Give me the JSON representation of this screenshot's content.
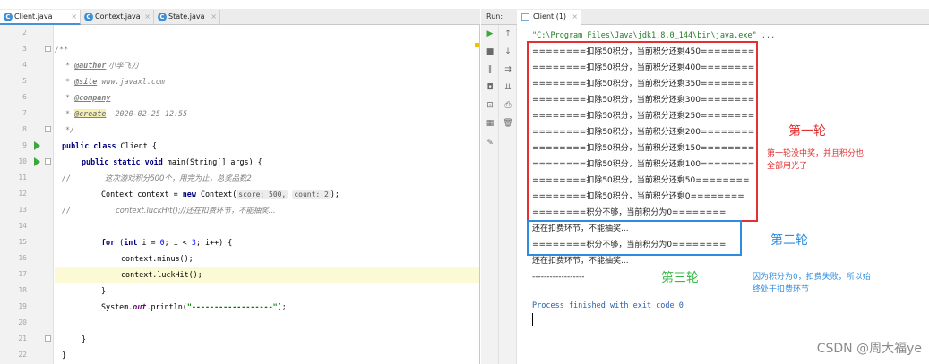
{
  "editor": {
    "tabs": [
      {
        "label": "Client.java",
        "active": true
      },
      {
        "label": "Context.java",
        "active": false
      },
      {
        "label": "State.java",
        "active": false
      }
    ],
    "line_numbers": [
      "2",
      "3",
      "4",
      "5",
      "6",
      "7",
      "8",
      "9",
      "10",
      "11",
      "12",
      "13",
      "14",
      "15",
      "16",
      "17",
      "18",
      "19",
      "20",
      "21",
      "22"
    ],
    "code": {
      "l3": "/**",
      "l4_tag": "@author",
      "l4_text": " 小李飞刀",
      "l5_tag": "@site",
      "l5_text": " www.javaxl.com",
      "l6_tag": "@company",
      "l7_tag": "@create",
      "l7_text": "  2020-02-25 12:55",
      "l8": "*/",
      "l9_kw": "public class",
      "l9_text": " Client {",
      "l10_kw": "public static void",
      "l10_text": " main(String[] args) {",
      "l11_c": "//",
      "l11_text": "这次游戏积分500个，用完为止，总奖品数2",
      "l12_a": "Context context = ",
      "l12_kw": "new",
      "l12_b": " Context(",
      "l12_hint1": "score: 500,",
      "l12_hint2": "count: 2",
      "l12_c": ");",
      "l13_c": "//",
      "l13_text": "context.luckHit();//还在扣费环节，不能抽奖...",
      "l15_kw": "for",
      "l15_a": " (",
      "l15_kw2": "int",
      "l15_b": " i = ",
      "l15_n1": "0",
      "l15_c": "; i < ",
      "l15_n2": "3",
      "l15_d": "; i++) {",
      "l16": "context.minus();",
      "l17": "context.luckHit();",
      "l18": "}",
      "l19_a": "System.",
      "l19_f": "out",
      "l19_b": ".println(",
      "l19_s": "\"------------------\"",
      "l19_c": ");",
      "l21": "}",
      "l22": "}"
    }
  },
  "run": {
    "label": "Run:",
    "tab": "Client (1)",
    "cmd": "\"C:\\Program Files\\Java\\jdk1.8.0_144\\bin\\java.exe\" ...",
    "lines": [
      "========扣除50积分，当前积分还剩450========",
      "========扣除50积分，当前积分还剩400========",
      "========扣除50积分，当前积分还剩350========",
      "========扣除50积分，当前积分还剩300========",
      "========扣除50积分，当前积分还剩250========",
      "========扣除50积分，当前积分还剩200========",
      "========扣除50积分，当前积分还剩150========",
      "========扣除50积分，当前积分还剩100========",
      "========扣除50积分，当前积分还剩50========",
      "========扣除50积分，当前积分还剩0========",
      "========积分不够，当前积分为0========",
      "还在扣费环节，不能抽奖...",
      "========积分不够，当前积分为0========",
      "还在扣费环节，不能抽奖...",
      "------------------"
    ],
    "exit": "Process finished with exit code 0"
  },
  "annotations": {
    "round1": "第一轮",
    "round1_note_1": "第一轮没中奖，并且积分也",
    "round1_note_2": "全部用光了",
    "round2": "第二轮",
    "round3": "第三轮",
    "round3_note_1": "因为积分为0，扣费失败，所以始",
    "round3_note_2": "终处于扣费环节"
  },
  "watermark": "CSDN @周大福ye",
  "colors": {
    "red_box": "#e33030",
    "blue_box": "#2d8ce0",
    "green_text": "#3cb84a"
  }
}
